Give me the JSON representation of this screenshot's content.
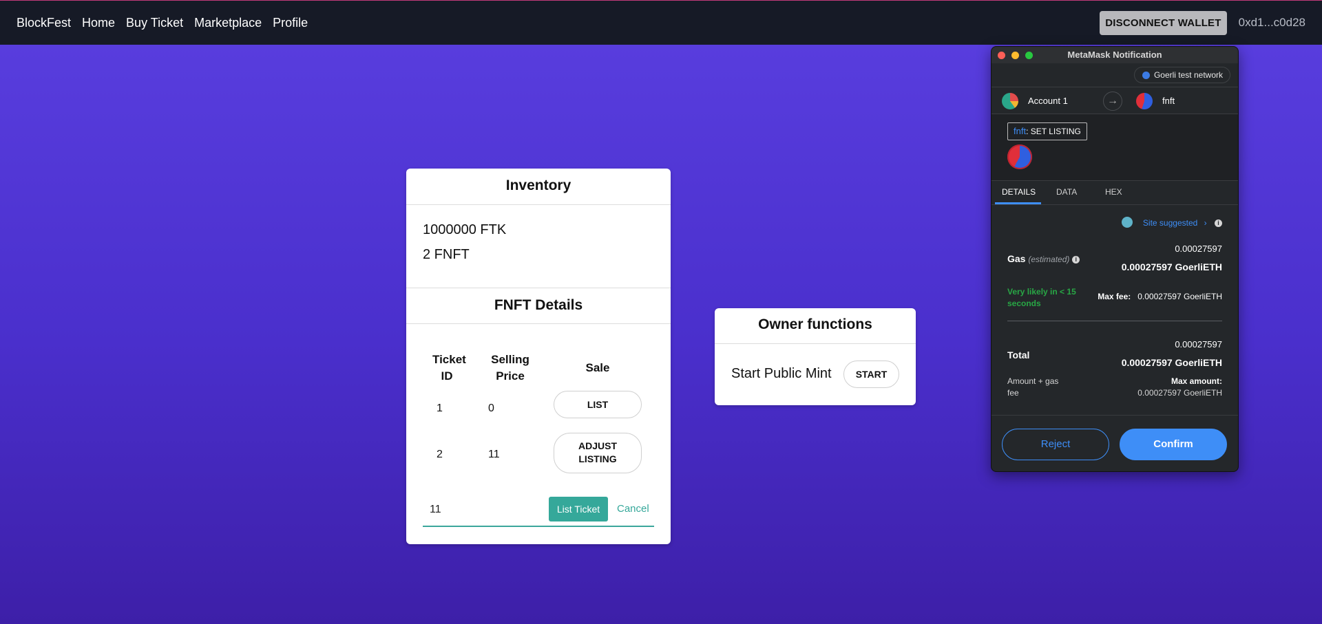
{
  "navbar": {
    "brand": "BlockFest",
    "links": [
      "Home",
      "Buy Ticket",
      "Marketplace",
      "Profile"
    ],
    "disconnect_label": "DISCONNECT WALLET",
    "address": "0xd1...c0d28"
  },
  "inventory": {
    "title": "Inventory",
    "balances": [
      "1000000 FTK",
      "2 FNFT"
    ],
    "details_title": "FNFT Details",
    "columns": [
      "Ticket ID",
      "Selling Price",
      "Sale"
    ],
    "rows": [
      {
        "ticket_id": "1",
        "price": "0",
        "action": "LIST"
      },
      {
        "ticket_id": "2",
        "price": "11",
        "action": "ADJUST LISTING"
      }
    ],
    "listing_input_value": "11",
    "list_ticket_label": "List Ticket",
    "cancel_label": "Cancel"
  },
  "owner": {
    "title": "Owner functions",
    "mint_label": "Start Public Mint",
    "start_label": "START"
  },
  "metamask": {
    "title": "MetaMask Notification",
    "network": "Goerli test network",
    "from_account": "Account 1",
    "to_contract": "fnft",
    "method_contract": "fnft",
    "method_name": ": SET LISTING",
    "tabs": [
      "DETAILS",
      "DATA",
      "HEX"
    ],
    "site_suggested": "Site suggested",
    "gas_label": "Gas",
    "gas_estimated": "(estimated)",
    "gas_value": "0.00027597",
    "gas_value_eth": "0.00027597 GoerliETH",
    "likely_text": "Very likely in < 15 seconds",
    "max_fee_label": "Max fee:",
    "max_fee_value": "0.00027597 GoerliETH",
    "total_label": "Total",
    "total_value": "0.00027597",
    "total_value_eth": "0.00027597 GoerliETH",
    "amount_gas_label": "Amount + gas fee",
    "max_amount_label": "Max amount:",
    "max_amount_value": "0.00027597 GoerliETH",
    "reject_label": "Reject",
    "confirm_label": "Confirm",
    "colors": {
      "accent": "#3e8ef7",
      "success": "#28a745"
    }
  }
}
